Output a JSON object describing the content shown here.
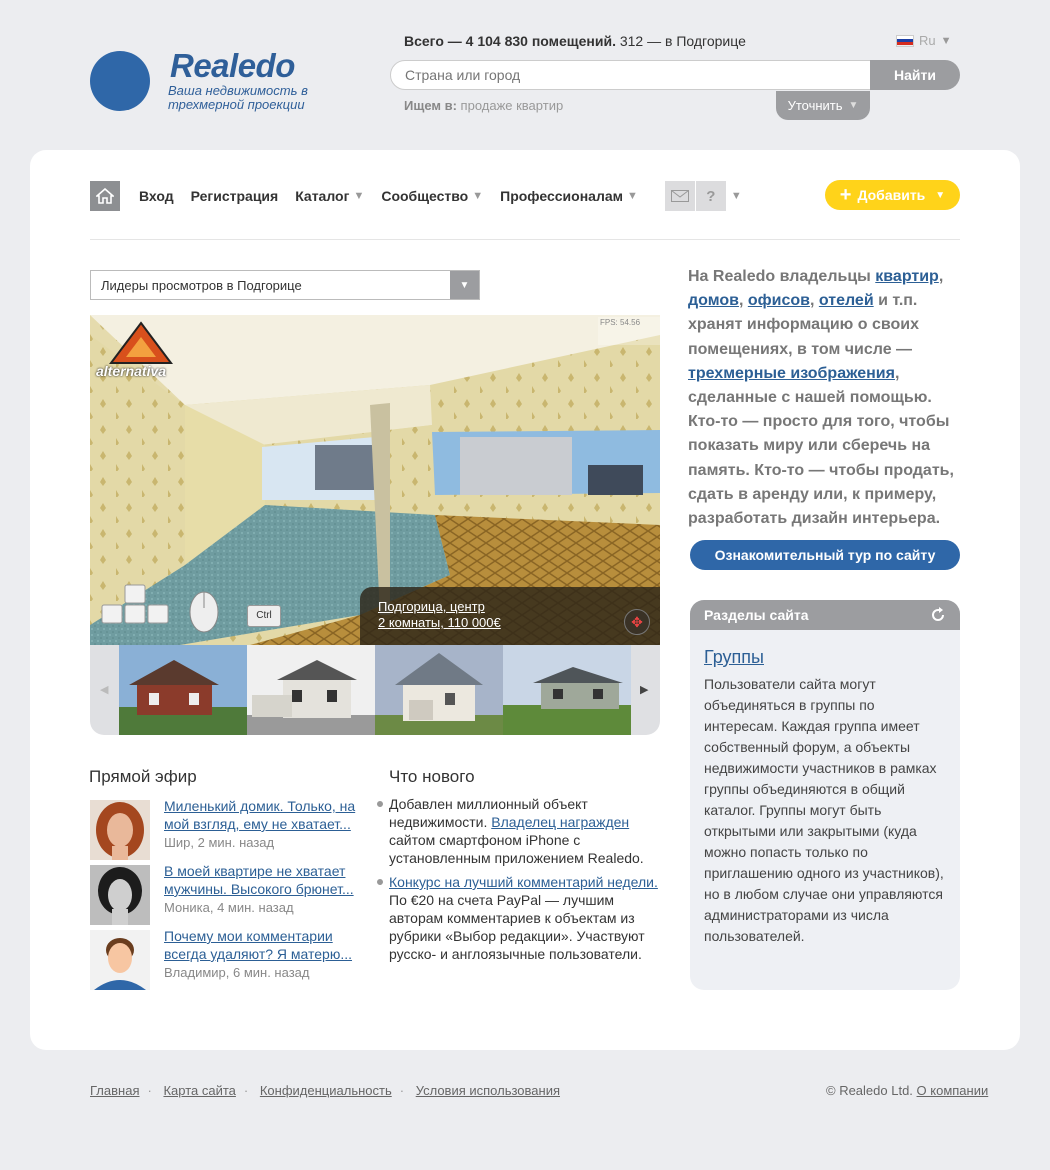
{
  "header": {
    "logo_name": "Realedo",
    "logo_tagline": "Ваша недвижимость в трехмерной проекции",
    "count_bold": "Всего — 4 104 830 помещений.",
    "count_rest": "312 — в Подгорице",
    "lang": "Ru",
    "search_placeholder": "Страна или город",
    "search_button": "Найти",
    "seek_label": "Ищем в:",
    "seek_value": "продаже квартир",
    "refine_label": "Уточнить"
  },
  "nav": {
    "items": [
      "Вход",
      "Регистрация",
      "Каталог",
      "Сообщество",
      "Профессионалам"
    ],
    "help_label": "?",
    "add_button": "Добавить"
  },
  "viewer": {
    "select_label": "Лидеры просмотров в Подгорице",
    "fps": "FPS: 54.56",
    "brand": "alternativa",
    "caption_line1": "Подгорица, центр",
    "caption_line2": "2 комнаты, 110 000€",
    "ctrl_key": "Ctrl"
  },
  "live": {
    "title": "Прямой эфир",
    "items": [
      {
        "text": "Миленький домик. Только, на мой взгляд, ему не хватает...",
        "meta": "Шир, 2 мин. назад"
      },
      {
        "text": "В моей квартире не хватает мужчины. Высокого брюнет...",
        "meta": "Моника, 4 мин. назад"
      },
      {
        "text": "Почему мои комментарии всегда удаляют? Я матерю...",
        "meta": "Владимир, 6 мин. назад"
      }
    ]
  },
  "news": {
    "title": "Что нового",
    "item1_pre": "Добавлен миллионный объект недвижимости.",
    "item1_link": "Владелец награжден",
    "item1_post": "сайтом смартфоном iPhone с установленным приложением Realedo.",
    "item2_link": "Конкурс на лучший комментарий недели.",
    "item2_post": "По €20 на счета PayPal — лучшим авторам комментариев к объектам из рубрики «Выбор редакции». Участвуют русско- и англоязычные пользователи."
  },
  "about": {
    "t1": "На Realedo владельцы",
    "l1": "квартир",
    "l2": "домов",
    "l3": "офисов",
    "l4": "отелей",
    "t2": "и т.п. хранят информацию о своих помещениях, в том числе —",
    "l5": "трехмерные изображения",
    "t3": ", сделанные с нашей помощью. Кто-то — просто для того, чтобы показать миру или сберечь на память. Кто-то — чтобы продать, сдать в аренду или, к примеру, разработать дизайн интерьера.",
    "tour_button": "Ознакомительный тур по сайту"
  },
  "sections": {
    "header": "Разделы сайта",
    "title": "Группы",
    "text": "Пользователи сайта могут объединяться в группы по интересам. Каждая группа имеет собственный форум, а  объекты недвижимости участников в рамках группы объединяются в общий каталог. Группы могут быть открытыми или закрытыми (куда можно попасть только по приглашению одного  из участников), но в любом случае они управляются  администраторами из числа пользователей."
  },
  "footer": {
    "links": [
      "Главная",
      "Карта сайта",
      "Конфиденциальность",
      "Условия использования"
    ],
    "copyright": "© Realedo Ltd.",
    "about_link": "О компании"
  }
}
